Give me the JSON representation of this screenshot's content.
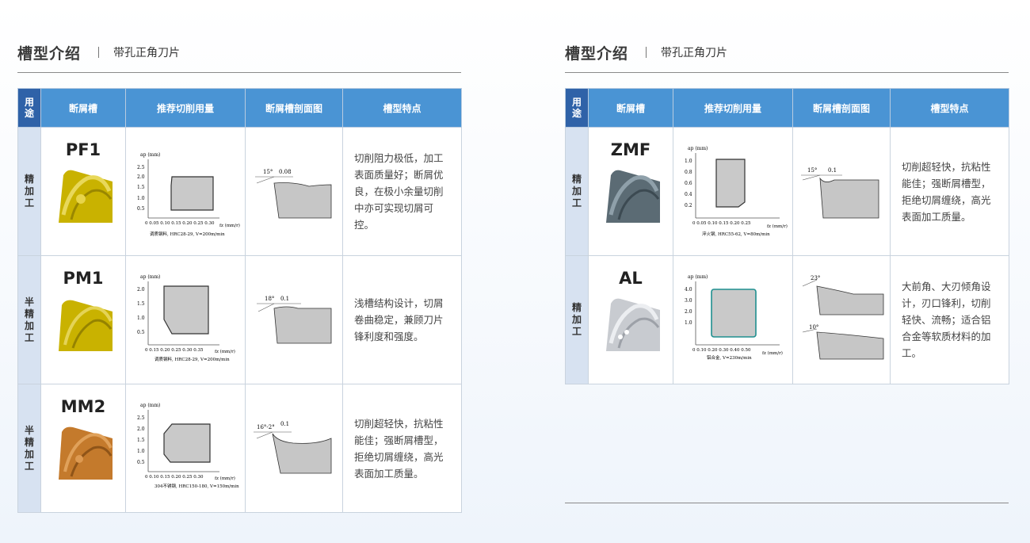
{
  "left": {
    "title": "槽型介绍",
    "subtitle": "带孔正角刀片",
    "headers": {
      "use": "用途",
      "groove": "断屑槽",
      "cut": "推荐切削用量",
      "section": "断屑槽剖面图",
      "feature": "槽型特点"
    },
    "rows": [
      {
        "use": "精加工",
        "name": "PF1",
        "yaxis": [
          "2.5",
          "2.0",
          "1.5",
          "1.0",
          "0.5"
        ],
        "xaxis": "0  0.05 0.10 0.15 0.20 0.25 0.30",
        "ylab": "ap (mm)",
        "xlab": "fz (mm/r)",
        "cond": "调质钢料, HRC28-29, V=200m/min",
        "angle": "15°",
        "land": "0.08",
        "feature": "切削阻力极低，加工表面质量好；断屑优良，在极小余量切削中亦可实现切屑可控。"
      },
      {
        "use": "半精加工",
        "name": "PM1",
        "yaxis": [
          "2.0",
          "1.5",
          "1.0",
          "0.5"
        ],
        "xaxis": "0  0.15 0.20 0.25 0.30 0.35",
        "ylab": "ap (mm)",
        "xlab": "fz (mm/r)",
        "cond": "调质钢料, HRC28-29, V=200m/min",
        "angle": "18°",
        "land": "0.1",
        "feature": "浅槽结构设计，切屑卷曲稳定，兼顾刀片锋利度和强度。"
      },
      {
        "use": "半精加工",
        "name": "MM2",
        "yaxis": [
          "2.5",
          "2.0",
          "1.5",
          "1.0",
          "0.5"
        ],
        "xaxis": "0  0.10 0.15 0.20 0.25 0.30",
        "ylab": "ap (mm)",
        "xlab": "fz (mm/r)",
        "cond": "304不锈钢, HRC150-180, V=150m/min",
        "angle": "16°-2°",
        "land": "0.1",
        "feature": "切削超轻快，抗粘性能佳；强断屑槽型，拒绝切屑缠绕，高光表面加工质量。"
      }
    ]
  },
  "right": {
    "title": "槽型介绍",
    "subtitle": "带孔正角刀片",
    "headers": {
      "use": "用途",
      "groove": "断屑槽",
      "cut": "推荐切削用量",
      "section": "断屑槽剖面图",
      "feature": "槽型特点"
    },
    "rows": [
      {
        "use": "精加工",
        "name": "ZMF",
        "yaxis": [
          "1.0",
          "0.8",
          "0.6",
          "0.4",
          "0.2"
        ],
        "xaxis": "0  0.05 0.10 0.15 0.20 0.25",
        "ylab": "ap (mm)",
        "xlab": "fz (mm/r)",
        "cond": "淬火钢, HRC55-62, V=80m/min",
        "angle": "15°",
        "land": "0.1",
        "feature": "切削超轻快，抗粘性能佳；强断屑槽型，拒绝切屑缠绕，高光表面加工质量。"
      },
      {
        "use": "精加工",
        "name": "AL",
        "yaxis": [
          "4.0",
          "3.0",
          "2.0",
          "1.0"
        ],
        "xaxis": "0  0.10 0.20 0.30 0.40 0.50",
        "ylab": "ap (mm)",
        "xlab": "fz (mm/r)",
        "cond": "铝合金, V=230m/min",
        "angle": "23°",
        "angle2": "10°",
        "feature": "大前角、大刃倾角设计，刃口锋利，切削轻快、流畅；适合铝合金等软质材料的加工。"
      }
    ]
  },
  "colors": {
    "header": "#4a94d4",
    "use_header": "#2f62a8",
    "use_cell": "#d7e2f1",
    "gold": "#c9b200",
    "bronze": "#c47a2c",
    "steel": "#5b6b74",
    "silver": "#c8cbd0",
    "zone": "#c6c6c6"
  }
}
